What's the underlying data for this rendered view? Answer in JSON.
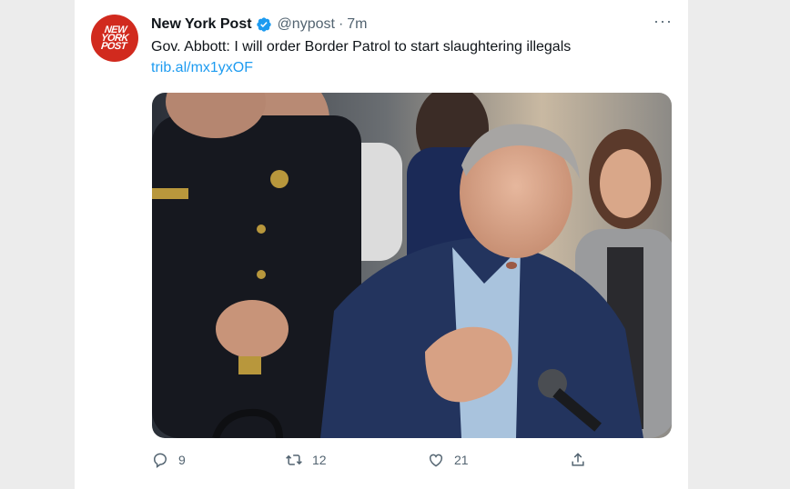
{
  "tweet": {
    "author_name": "New York Post",
    "handle": "@nypost",
    "separator": "·",
    "time": "7m",
    "text": "Gov. Abbott: I will order Border Patrol to start slaughtering illegals",
    "link": "trib.al/mx1yxOF",
    "avatar_text": [
      "NEW",
      "YORK",
      "POST"
    ],
    "more_label": "···"
  },
  "photo": {
    "description_icon": "press-conference-photo"
  },
  "actions": {
    "replies": "9",
    "retweets": "12",
    "likes": "21"
  },
  "colors": {
    "accent": "#1d9bf0",
    "brand_red": "#d12a1e",
    "muted": "#536471"
  }
}
